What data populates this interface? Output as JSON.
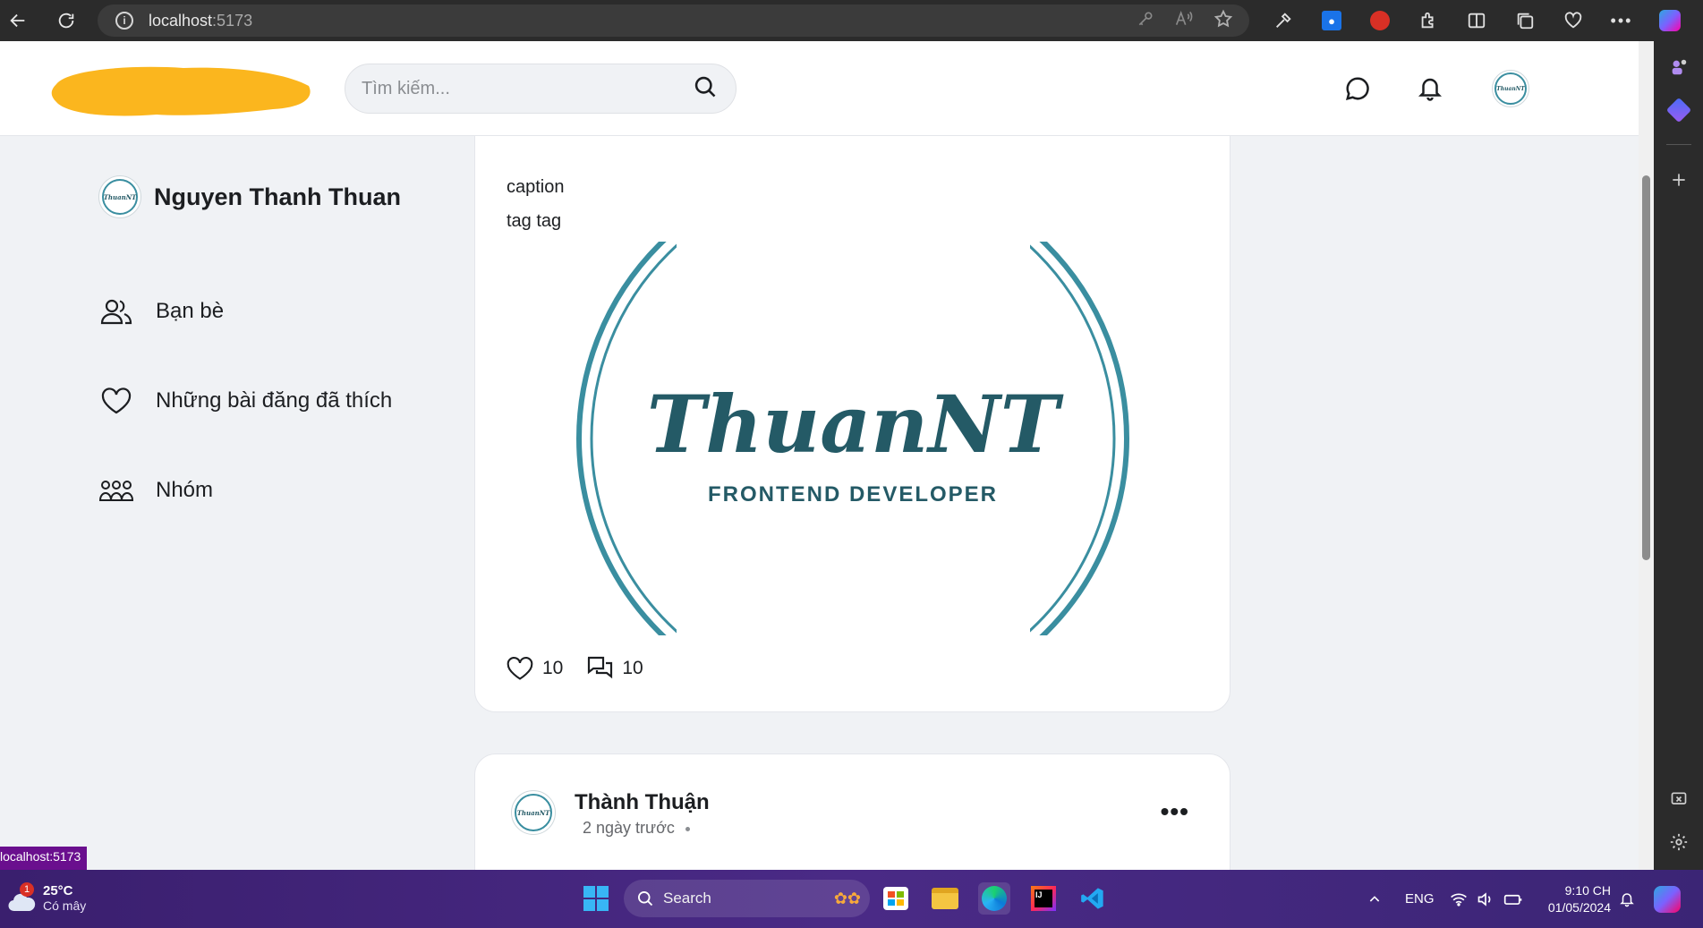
{
  "browser": {
    "url_host": "localhost",
    "url_port": ":5173"
  },
  "header": {
    "search_placeholder": "Tìm kiếm..."
  },
  "sidebar": {
    "profile_name": "Nguyen Thanh Thuan",
    "items": [
      {
        "label": "Bạn bè",
        "icon": "friends-icon"
      },
      {
        "label": "Những bài đăng đã thích",
        "icon": "heart-icon"
      },
      {
        "label": "Nhóm",
        "icon": "group-icon"
      }
    ]
  },
  "posts": [
    {
      "caption": "caption",
      "tags": "tag tag",
      "image": {
        "title": "ThuanNT",
        "subtitle": "FRONTEND DEVELOPER"
      },
      "likes": "10",
      "comments": "10"
    },
    {
      "author": "Thành Thuận",
      "time": "2 ngày trước"
    }
  ],
  "avatar_text": "ThuanNT",
  "status_tip": "localhost:5173",
  "taskbar": {
    "weather_badge": "1",
    "temperature": "25°C",
    "weather_desc": "Có mây",
    "search_label": "Search",
    "language": "ENG",
    "time": "9:10 CH",
    "date": "01/05/2024"
  },
  "colors": {
    "brand_teal": "#3a8ea0",
    "logo_text": "#245a66",
    "logo_blob": "#fbb61e",
    "taskbar": "#4a2a86"
  }
}
